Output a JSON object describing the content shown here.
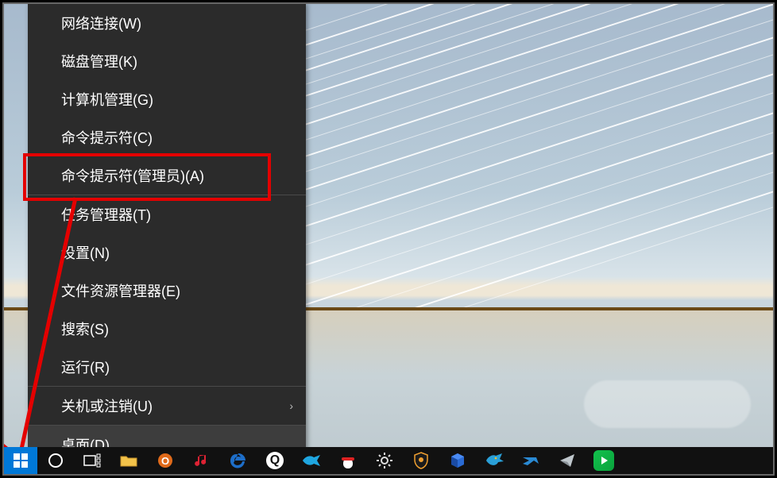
{
  "menu": {
    "items": [
      {
        "label": "网络连接(W)"
      },
      {
        "label": "磁盘管理(K)"
      },
      {
        "label": "计算机管理(G)"
      },
      {
        "label": "命令提示符(C)"
      },
      {
        "label": "命令提示符(管理员)(A)",
        "highlighted": true
      },
      {
        "label": "任务管理器(T)"
      },
      {
        "label": "设置(N)"
      },
      {
        "label": "文件资源管理器(E)"
      },
      {
        "label": "搜索(S)"
      },
      {
        "label": "运行(R)"
      },
      {
        "label": "关机或注销(U)",
        "submenu": true
      },
      {
        "label": "桌面(D)",
        "hovered": true
      }
    ]
  },
  "taskbar": {
    "start": "start-button",
    "icons": [
      "cortana",
      "task-view",
      "folders",
      "browser-o",
      "music",
      "edge",
      "browser-q",
      "swift-app",
      "qq",
      "settings-gear",
      "av-shield",
      "cube-app",
      "eagle-app",
      "swift-blue",
      "paper-plane",
      "video-play"
    ]
  },
  "annotations": {
    "highlighted_item_index": 4,
    "arrow_points_to": "start-button"
  },
  "colors": {
    "highlight_border": "#e40000",
    "arrow": "#e40000",
    "menu_bg": "#2b2b2b",
    "start_bg": "#0078d7"
  },
  "sub_indicator_glyph": "›"
}
